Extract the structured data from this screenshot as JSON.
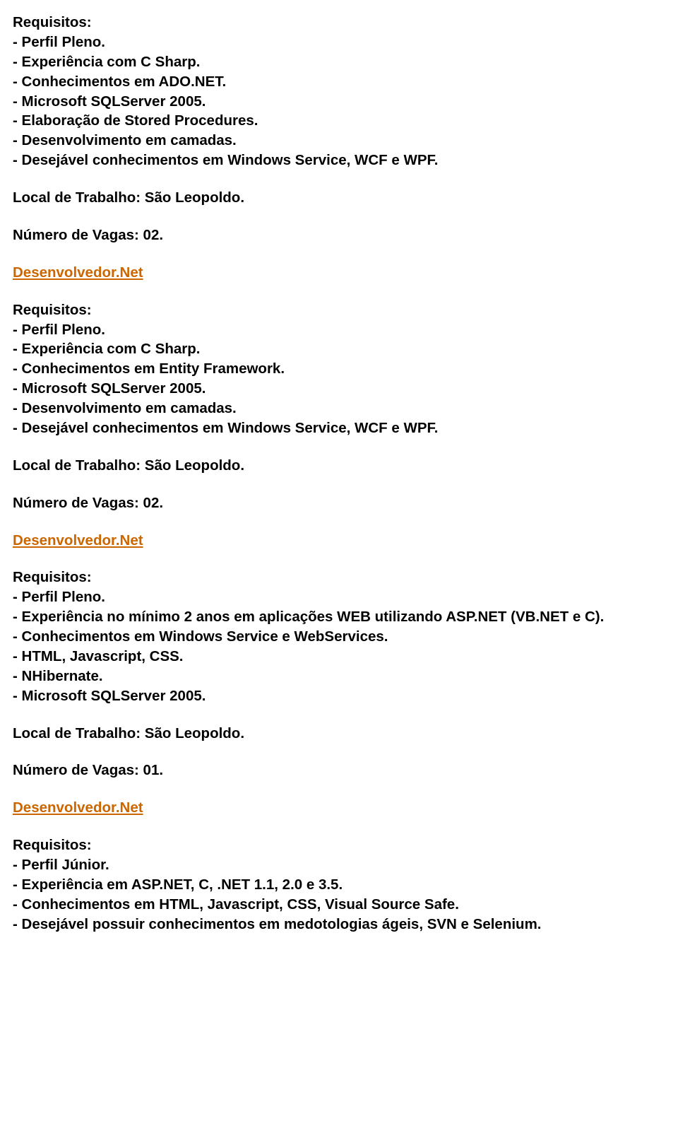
{
  "job1": {
    "req_label": "Requisitos:",
    "r1": "- Perfil Pleno.",
    "r2": "- Experiência com C Sharp.",
    "r3": "- Conhecimentos em ADO.NET.",
    "r4": "- Microsoft SQLServer 2005.",
    "r5": "- Elaboração de Stored Procedures.",
    "r6": "- Desenvolvimento em camadas.",
    "r7": "- Desejável conhecimentos em Windows Service, WCF e WPF.",
    "local": "Local de Trabalho: São Leopoldo.",
    "vagas": "Número de Vagas: 02."
  },
  "job2": {
    "title": "Desenvolvedor.Net",
    "req_label": "Requisitos:",
    "r1": "- Perfil Pleno.",
    "r2": "- Experiência com C Sharp.",
    "r3": "- Conhecimentos em Entity Framework.",
    "r4": "- Microsoft SQLServer 2005.",
    "r5": "- Desenvolvimento em camadas.",
    "r6": "- Desejável conhecimentos em Windows Service, WCF e WPF.",
    "local": "Local de Trabalho: São Leopoldo.",
    "vagas": "Número de Vagas: 02."
  },
  "job3": {
    "title": "Desenvolvedor.Net",
    "req_label": "Requisitos:",
    "r1": "- Perfil Pleno.",
    "r2": "- Experiência no mínimo 2 anos em aplicações WEB utilizando ASP.NET (VB.NET e C).",
    "r3": "- Conhecimentos em Windows Service e WebServices.",
    "r4": "- HTML, Javascript, CSS.",
    "r5": "- NHibernate.",
    "r6": "- Microsoft SQLServer 2005.",
    "local": "Local de Trabalho: São Leopoldo.",
    "vagas": "Número de Vagas: 01."
  },
  "job4": {
    "title": "Desenvolvedor.Net",
    "req_label": "Requisitos:",
    "r1": "- Perfil Júnior.",
    "r2": "- Experiência em ASP.NET, C, .NET 1.1, 2.0 e 3.5.",
    "r3": "- Conhecimentos em HTML, Javascript, CSS, Visual Source Safe.",
    "r4": "- Desejável possuir conhecimentos em medotologias ágeis, SVN e Selenium."
  }
}
